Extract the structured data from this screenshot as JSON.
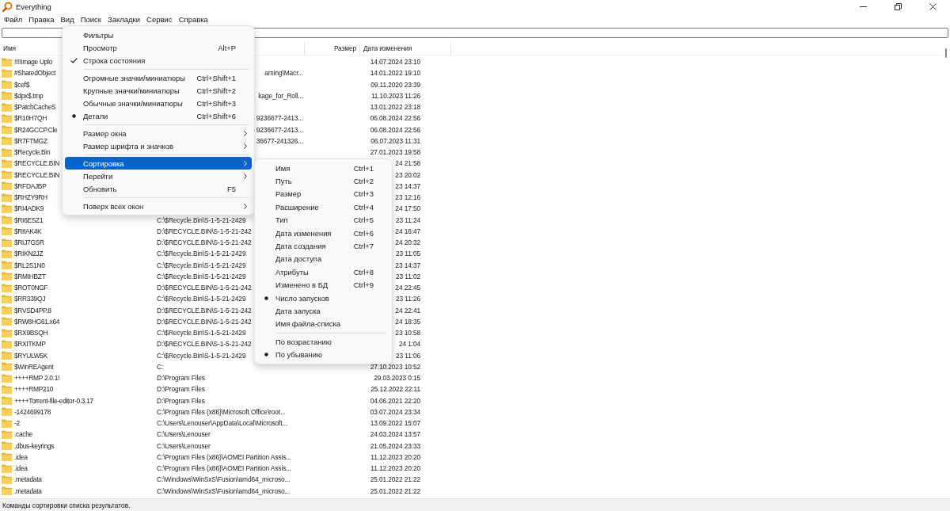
{
  "window": {
    "title": "Everything"
  },
  "menubar": [
    "Файл",
    "Правка",
    "Вид",
    "Поиск",
    "Закладки",
    "Сервис",
    "Справка"
  ],
  "table": {
    "header": {
      "name": "Имя",
      "size": "Размер",
      "modified": "Дата изменения"
    },
    "rows": [
      {
        "name": "!!!!Image Uplo",
        "modified": "14.07.2024 23:10"
      },
      {
        "name": "#SharedObject",
        "path": "aming\\Macr...",
        "path_cut_at_start": true,
        "modified": "14.01.2022 19:10"
      },
      {
        "name": "$cef$",
        "modified": "09.11.2020 23:39"
      },
      {
        "name": "$dpx$.tmp",
        "path": "kage_for_Roll...",
        "path_cut_at_start": true,
        "modified": "11.10.2023 11:26"
      },
      {
        "name": "$PatchCacheS",
        "modified": "13.01.2022 23:18"
      },
      {
        "name": "$R10H7QH",
        "path": "9236677-2413...",
        "path_cut_at_start": true,
        "modified": "06.08.2024 22:56"
      },
      {
        "name": "$R24GCCP.Cle",
        "path": "9236677-2413...",
        "path_cut_at_start": true,
        "modified": "06.08.2024 22:56"
      },
      {
        "name": "$R7FTMGZ",
        "path": "36677-241326...",
        "path_cut_at_start": true,
        "modified": "06.07.2023 11:31"
      },
      {
        "name": "$Recycle.Bin",
        "modified": "27.01.2023 19:58"
      },
      {
        "name": "$RECYCLE.BIN",
        "modified": "24 21:58"
      },
      {
        "name": "$RECYCLE.BIN",
        "modified": "23 20:02"
      },
      {
        "name": "$RFDAJBP",
        "modified": "23 14:37"
      },
      {
        "name": "$RHZY9RH",
        "modified": "23 12:16"
      },
      {
        "name": "$RI4ADK9",
        "modified": "24 17:50"
      },
      {
        "name": "$RI6ESZ1",
        "path": "C:\\$Recycle.Bin\\S-1-5-21-2429",
        "modified": "23 11:24"
      },
      {
        "name": "$RIIAK4K",
        "path": "D:\\$RECYCLE.BIN\\S-1-5-21-242",
        "modified": "24 16:47"
      },
      {
        "name": "$RIJ7GSR",
        "path": "D:\\$RECYCLE.BIN\\S-1-5-21-242",
        "modified": "24 20:32"
      },
      {
        "name": "$RIKN2JZ",
        "path": "C:\\$Recycle.Bin\\S-1-5-21-2429",
        "modified": "23 11:05"
      },
      {
        "name": "$RL2S1N0",
        "path": "C:\\$Recycle.Bin\\S-1-5-21-2429",
        "modified": "23 14:37"
      },
      {
        "name": "$RMIHBZT",
        "path": "C:\\$Recycle.Bin\\S-1-5-21-2429",
        "modified": "23 11:02"
      },
      {
        "name": "$ROT0NGF",
        "path": "D:\\$RECYCLE.BIN\\S-1-5-21-242",
        "modified": "24 22:45"
      },
      {
        "name": "$RR339QJ",
        "path": "C:\\$Recycle.Bin\\S-1-5-21-2429",
        "modified": "23 11:26"
      },
      {
        "name": "$RVSD4PP.8",
        "path": "D:\\$RECYCLE.BIN\\S-1-5-21-242",
        "modified": "24 22:41"
      },
      {
        "name": "$RW8HG61.x64",
        "path": "D:\\$RECYCLE.BIN\\S-1-5-21-242",
        "modified": "24 18:35"
      },
      {
        "name": "$RX9BSQH",
        "path": "C:\\$Recycle.Bin\\S-1-5-21-2429",
        "modified": "23 10:58"
      },
      {
        "name": "$RXITKMP",
        "path": "D:\\$RECYCLE.BIN\\S-1-5-21-242",
        "modified": "24 1:04"
      },
      {
        "name": "$RYULW5K",
        "path": "C:\\$Recycle.Bin\\S-1-5-21-2429",
        "modified": "23 11:06"
      },
      {
        "name": "$WinREAgent",
        "path": "C:",
        "modified": "27.10.2023 10:52"
      },
      {
        "name": "++++RMP 2.0.1!",
        "path": "D:\\Program Files",
        "modified": "29.03.2023 0:15"
      },
      {
        "name": "++++RMP210",
        "path": "D:\\Program Files",
        "modified": "25.12.2022 22:11"
      },
      {
        "name": "++++Torrent-file-editor-0.3.17",
        "path": "D:\\Program Files",
        "modified": "04.06.2021 22:20"
      },
      {
        "name": "-1424699178",
        "path": "C:\\Program Files (x86)\\Microsoft Office\\root...",
        "modified": "03.07.2024 23:34"
      },
      {
        "name": "-2",
        "path": "C:\\Users\\Lenouser\\AppData\\Local\\Microsoft...",
        "modified": "13.09.2022 15:07"
      },
      {
        "name": ".cache",
        "path": "C:\\Users\\Lenouser",
        "modified": "24.03.2024 13:57"
      },
      {
        "name": ".dbus-keyrings",
        "path": "C:\\Users\\Lenouser",
        "modified": "21.05.2024 23:33"
      },
      {
        "name": ".idea",
        "path": "C:\\Program Files (x86)\\AOMEI Partition Assis...",
        "modified": "11.12.2023 20:20"
      },
      {
        "name": ".idea",
        "path": "C:\\Program Files (x86)\\AOMEI Partition Assis...",
        "modified": "11.12.2023 20:20"
      },
      {
        "name": ".metadata",
        "path": "C:\\Windows\\WinSxS\\Fusion\\amd64_microso...",
        "modified": "25.01.2022 21:22"
      },
      {
        "name": ".metadata",
        "path": "C:\\Windows\\WinSxS\\Fusion\\amd64_microso...",
        "modified": "25.01.2022 21:22"
      }
    ]
  },
  "view_menu": {
    "items": [
      {
        "kind": "item",
        "label": "Фильтры",
        "checked": false,
        "selected": false,
        "submenu": false
      },
      {
        "kind": "item",
        "label": "Просмотр",
        "shortcut": "Alt+P",
        "checked": false,
        "selected": false,
        "submenu": false
      },
      {
        "kind": "check",
        "label": "Строка состояния",
        "checked": true,
        "selected": false,
        "submenu": false
      },
      {
        "kind": "separator"
      },
      {
        "kind": "item",
        "label": "Огромные значки/миниатюры",
        "shortcut": "Ctrl+Shift+1",
        "checked": false,
        "selected": false,
        "submenu": false
      },
      {
        "kind": "item",
        "label": "Крупные значки/миниатюры",
        "shortcut": "Ctrl+Shift+2",
        "checked": false,
        "selected": false,
        "submenu": false
      },
      {
        "kind": "item",
        "label": "Обычные значки/миниатюры",
        "shortcut": "Ctrl+Shift+3",
        "checked": false,
        "selected": false,
        "submenu": false
      },
      {
        "kind": "radio",
        "label": "Детали",
        "shortcut": "Ctrl+Shift+6",
        "checked": true,
        "selected": false,
        "submenu": false
      },
      {
        "kind": "separator"
      },
      {
        "kind": "item",
        "label": "Размер окна",
        "checked": false,
        "selected": false,
        "submenu": true
      },
      {
        "kind": "item",
        "label": "Размер шрифта и значков",
        "checked": false,
        "selected": false,
        "submenu": true
      },
      {
        "kind": "separator"
      },
      {
        "kind": "item",
        "label": "Сортировка",
        "checked": false,
        "selected": true,
        "submenu": true
      },
      {
        "kind": "item",
        "label": "Перейти",
        "checked": false,
        "selected": false,
        "submenu": true
      },
      {
        "kind": "item",
        "label": "Обновить",
        "shortcut": "F5",
        "checked": false,
        "selected": false,
        "submenu": false
      },
      {
        "kind": "separator"
      },
      {
        "kind": "item",
        "label": "Поверх всех окон",
        "checked": false,
        "selected": false,
        "submenu": true
      }
    ]
  },
  "sort_submenu": {
    "items": [
      {
        "kind": "item",
        "label": "Имя",
        "shortcut": "Ctrl+1",
        "checked": false,
        "selected": false,
        "submenu": false
      },
      {
        "kind": "item",
        "label": "Путь",
        "shortcut": "Ctrl+2",
        "checked": false,
        "selected": false,
        "submenu": false
      },
      {
        "kind": "item",
        "label": "Размер",
        "shortcut": "Ctrl+3",
        "checked": false,
        "selected": false,
        "submenu": false
      },
      {
        "kind": "item",
        "label": "Расширение",
        "shortcut": "Ctrl+4",
        "checked": false,
        "selected": false,
        "submenu": false
      },
      {
        "kind": "item",
        "label": "Тип",
        "shortcut": "Ctrl+5",
        "checked": false,
        "selected": false,
        "submenu": false
      },
      {
        "kind": "item",
        "label": "Дата изменения",
        "shortcut": "Ctrl+6",
        "checked": false,
        "selected": false,
        "submenu": false
      },
      {
        "kind": "item",
        "label": "Дата создания",
        "shortcut": "Ctrl+7",
        "checked": false,
        "selected": false,
        "submenu": false
      },
      {
        "kind": "item",
        "label": "Дата доступа",
        "checked": false,
        "selected": false,
        "submenu": false
      },
      {
        "kind": "item",
        "label": "Атрибуты",
        "shortcut": "Ctrl+8",
        "checked": false,
        "selected": false,
        "submenu": false
      },
      {
        "kind": "item",
        "label": "Изменено в БД",
        "shortcut": "Ctrl+9",
        "checked": false,
        "selected": false,
        "submenu": false
      },
      {
        "kind": "radio",
        "label": "Число запусков",
        "checked": true,
        "selected": false,
        "submenu": false
      },
      {
        "kind": "item",
        "label": "Дата запуска",
        "checked": false,
        "selected": false,
        "submenu": false
      },
      {
        "kind": "item",
        "label": "Имя файла-списка",
        "checked": false,
        "selected": false,
        "submenu": false
      },
      {
        "kind": "separator"
      },
      {
        "kind": "item",
        "label": "По возрастанию",
        "checked": false,
        "selected": false,
        "submenu": false
      },
      {
        "kind": "radio",
        "label": "По убыванию",
        "checked": true,
        "selected": false,
        "submenu": false
      }
    ]
  },
  "status_bar": "Команды сортировки списка результатов."
}
